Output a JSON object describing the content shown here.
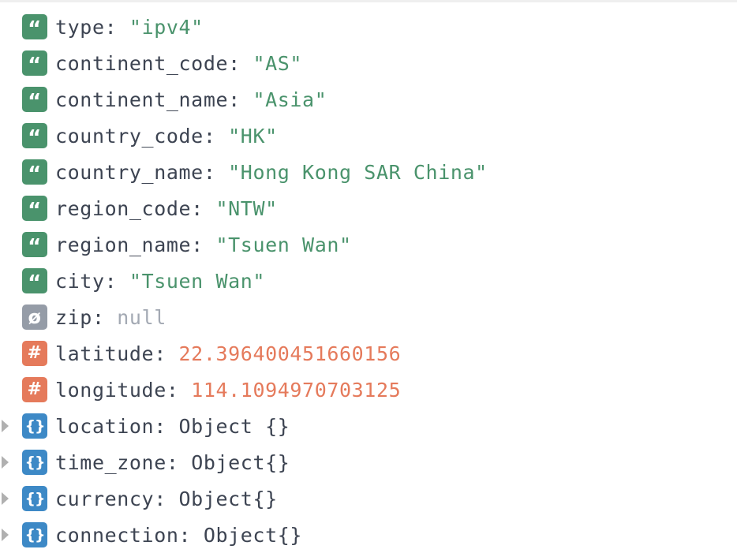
{
  "colors": {
    "string_badge": "#4a936c",
    "null_badge": "#959ca7",
    "number_badge": "#e57a5b",
    "object_badge": "#3d89c6",
    "key_text": "#3d4452",
    "string_value": "#4a936c",
    "number_value": "#e57a5b",
    "null_value": "#a3a9b3"
  },
  "icons": {
    "string": "“",
    "null": "ø",
    "number": "#",
    "object": "{}"
  },
  "rows": [
    {
      "key": "type",
      "value": "\"ipv4\"",
      "kind": "string",
      "expandable": false
    },
    {
      "key": "continent_code",
      "value": "\"AS\"",
      "kind": "string",
      "expandable": false
    },
    {
      "key": "continent_name",
      "value": "\"Asia\"",
      "kind": "string",
      "expandable": false
    },
    {
      "key": "country_code",
      "value": "\"HK\"",
      "kind": "string",
      "expandable": false
    },
    {
      "key": "country_name",
      "value": "\"Hong Kong SAR China\"",
      "kind": "string",
      "expandable": false
    },
    {
      "key": "region_code",
      "value": "\"NTW\"",
      "kind": "string",
      "expandable": false
    },
    {
      "key": "region_name",
      "value": "\"Tsuen Wan\"",
      "kind": "string",
      "expandable": false
    },
    {
      "key": "city",
      "value": "\"Tsuen Wan\"",
      "kind": "string",
      "expandable": false
    },
    {
      "key": "zip",
      "value": "null",
      "kind": "null",
      "expandable": false
    },
    {
      "key": "latitude",
      "value": "22.396400451660156",
      "kind": "number",
      "expandable": false
    },
    {
      "key": "longitude",
      "value": "114.1094970703125",
      "kind": "number",
      "expandable": false
    },
    {
      "key": "location",
      "value": "Object {}",
      "kind": "object",
      "expandable": true
    },
    {
      "key": "time_zone",
      "value": "Object{}",
      "kind": "object",
      "expandable": true
    },
    {
      "key": "currency",
      "value": "Object{}",
      "kind": "object",
      "expandable": true
    },
    {
      "key": "connection",
      "value": "Object{}",
      "kind": "object",
      "expandable": true
    }
  ]
}
